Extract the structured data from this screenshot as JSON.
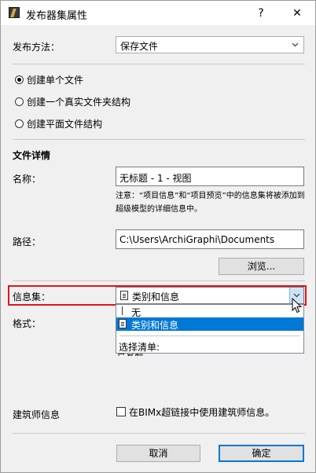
{
  "window": {
    "title": "发布器集属性",
    "help_glyph": "?",
    "close_glyph": "✕"
  },
  "publish_method": {
    "label": "发布方法：",
    "value": "保存文件"
  },
  "options": [
    {
      "label": "创建单个文件",
      "selected": true
    },
    {
      "label": "创建一个真实文件夹结构",
      "selected": false
    },
    {
      "label": "创建平面文件结构",
      "selected": false
    }
  ],
  "file_details": {
    "heading": "文件详情",
    "name_label": "名称：",
    "name_value": "无标题 - 1 - 视图",
    "note": "注意：“项目信息”和“项目预览”中的信息集将被添加到超级模型的详细信息中。",
    "path_label": "路径：",
    "path_value": "C:\\Users\\ArchiGraphi\\Documents",
    "browse_label": "浏览..."
  },
  "info_set": {
    "label": "信息集：",
    "value": "类别和信息",
    "dropdown_items": [
      "无",
      "类别和信息",
      "选择清单:"
    ],
    "partial_hidden_text": "已复制"
  },
  "format": {
    "label": "格式："
  },
  "architect_info": {
    "label": "建筑师信息",
    "checkbox_label": "在BIMx超链接中使用建筑师信息。"
  },
  "footer": {
    "cancel_label": "取消",
    "ok_label": "确定"
  }
}
